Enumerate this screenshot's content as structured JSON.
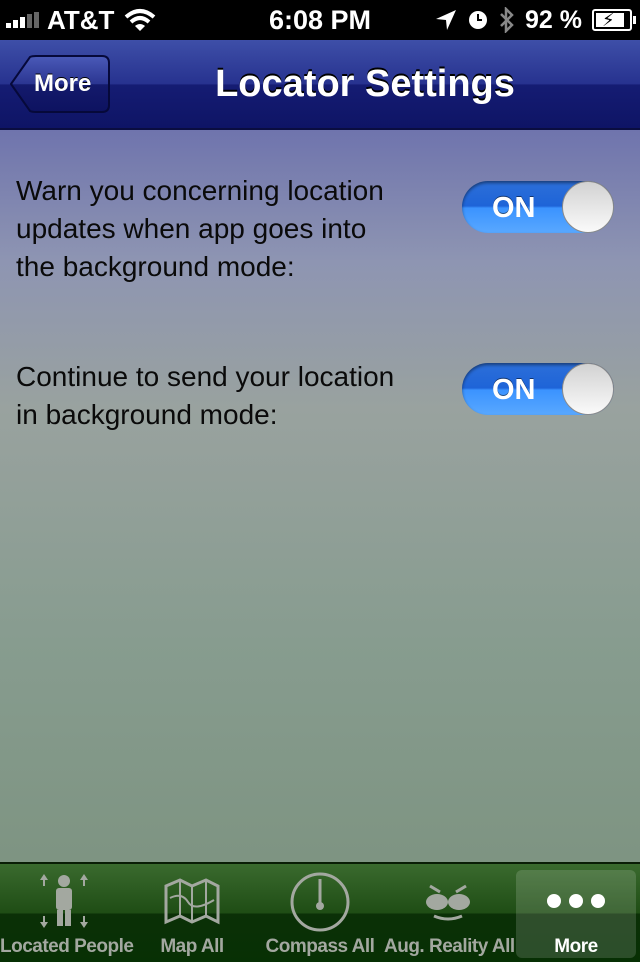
{
  "status_bar": {
    "carrier": "AT&T",
    "time": "6:08 PM",
    "battery_percent": "92 %",
    "icons": [
      "signal-icon",
      "wifi-icon",
      "location-arrow-icon",
      "alarm-clock-icon",
      "bluetooth-icon",
      "battery-charging-icon"
    ]
  },
  "nav_bar": {
    "back_label": "More",
    "title": "Locator Settings"
  },
  "settings": [
    {
      "label": "Warn you concerning location updates when app goes into the background mode:",
      "toggle": "ON",
      "enabled": true
    },
    {
      "label": "Continue to send your location in background mode:",
      "toggle": "ON",
      "enabled": true
    }
  ],
  "tab_bar": {
    "tabs": [
      {
        "label": "Located People",
        "icon": "people-icon",
        "active": false
      },
      {
        "label": "Map All",
        "icon": "map-icon",
        "active": false
      },
      {
        "label": "Compass All",
        "icon": "compass-icon",
        "active": false
      },
      {
        "label": "Aug. Reality All",
        "icon": "face-glasses-icon",
        "active": false
      },
      {
        "label": "More",
        "icon": "more-dots-icon",
        "active": true
      }
    ]
  },
  "colors": {
    "nav_blue": "#1a2280",
    "toggle_blue": "#2e7ef0",
    "tab_green": "#1f4d15"
  }
}
